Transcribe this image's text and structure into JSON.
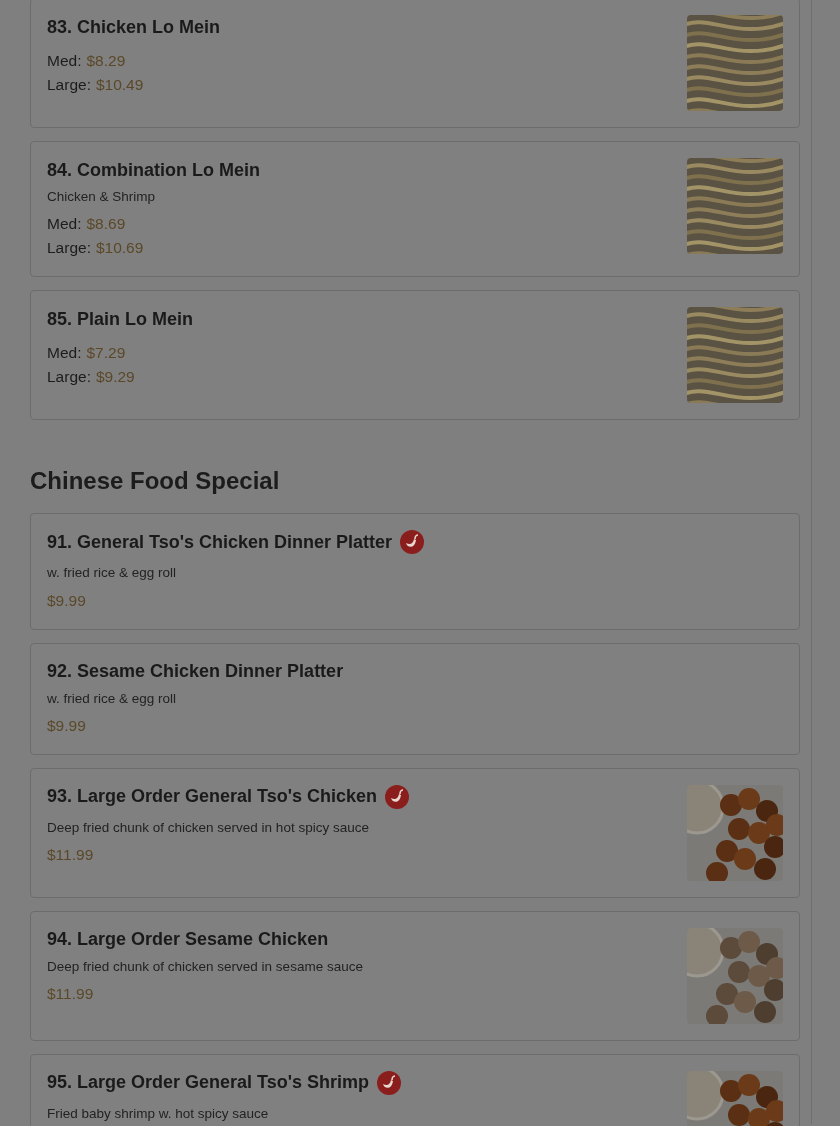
{
  "sections": [
    {
      "items": [
        {
          "name": "83. Chicken Lo Mein",
          "spicy": false,
          "prices": [
            {
              "label": "Med:",
              "amount": "$8.29"
            },
            {
              "label": "Large:",
              "amount": "$10.49"
            }
          ],
          "photo": {
            "kind": "picture"
          }
        },
        {
          "name": "84. Combination Lo Mein",
          "spicy": false,
          "description": "Chicken & Shrimp",
          "prices": [
            {
              "label": "Med:",
              "amount": "$8.69"
            },
            {
              "label": "Large:",
              "amount": "$10.69"
            }
          ],
          "photo": {
            "kind": "picture"
          }
        },
        {
          "name": "85. Plain Lo Mein",
          "spicy": false,
          "prices": [
            {
              "label": "Med:",
              "amount": "$7.29"
            },
            {
              "label": "Large:",
              "amount": "$9.29"
            }
          ],
          "photo": {
            "kind": "picture"
          }
        }
      ]
    },
    {
      "title": "Chinese Food Special",
      "items": [
        {
          "name": "91. General Tso's Chicken Dinner Platter",
          "spicy": true,
          "description": "w. fried rice & egg roll",
          "prices": [
            {
              "amount": "$9.99"
            }
          ]
        },
        {
          "name": "92. Sesame Chicken Dinner Platter",
          "spicy": false,
          "description": "w. fried rice & egg roll",
          "prices": [
            {
              "amount": "$9.99"
            }
          ]
        },
        {
          "name": "93. Large Order General Tso's Chicken",
          "spicy": true,
          "description": "Deep fried chunk of chicken served in hot spicy sauce",
          "prices": [
            {
              "amount": "$11.99"
            }
          ],
          "photo": {
            "kind": "picture"
          }
        },
        {
          "name": "94. Large Order Sesame Chicken",
          "spicy": false,
          "description": "Deep fried chunk of chicken served in sesame sauce",
          "prices": [
            {
              "amount": "$11.99"
            }
          ],
          "photo": {
            "kind": "picture"
          }
        },
        {
          "name": "95. Large Order General Tso's Shrimp",
          "spicy": true,
          "description": "Fried baby shrimp w. hot spicy sauce",
          "photo": {
            "kind": "picture"
          }
        }
      ]
    }
  ]
}
